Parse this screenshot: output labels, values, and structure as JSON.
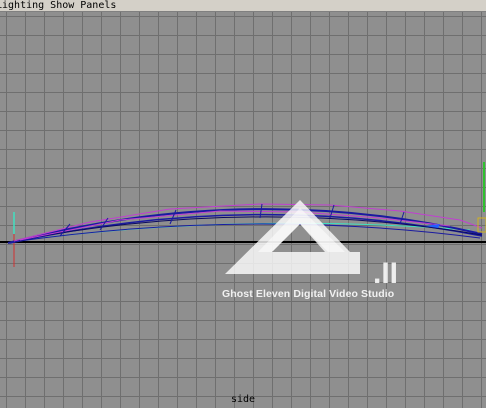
{
  "menubar": {
    "items": [
      "Lighting",
      "Show",
      "Panels"
    ]
  },
  "viewport": {
    "camera_label": "side"
  },
  "watermark": {
    "mark": ".II",
    "studio": "Ghost Eleven Digital Video Studio"
  },
  "colors": {
    "grid_bg": "#8f8f8f",
    "grid_line": "#6f6f6f",
    "curve_blue": "#1a1aa0",
    "curve_magenta": "#c040d0",
    "curve_cyan": "#40e0c0"
  }
}
